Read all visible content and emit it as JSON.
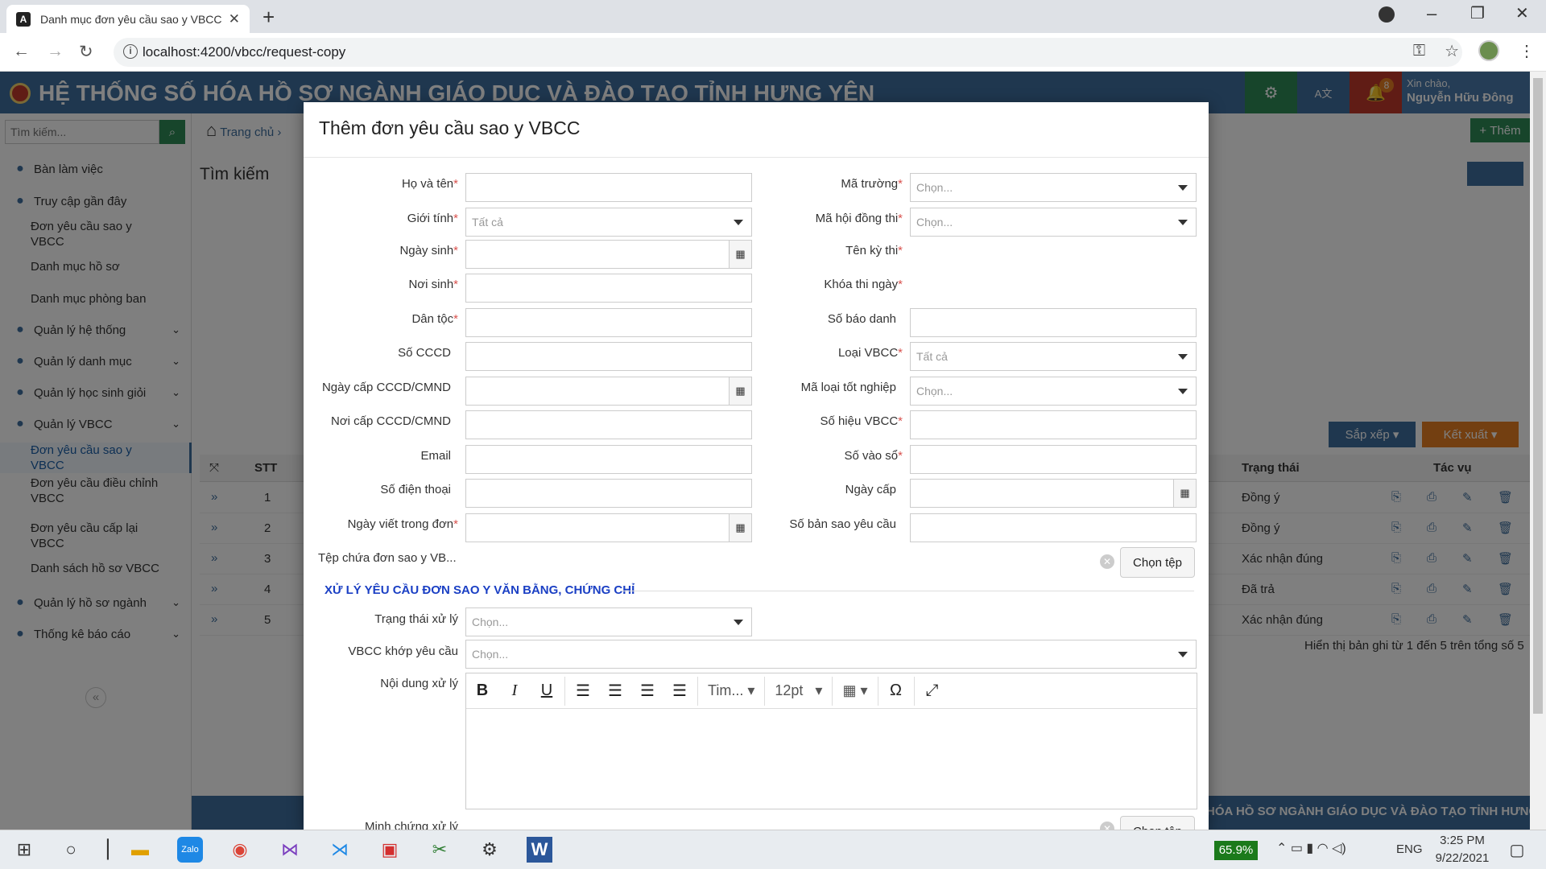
{
  "browser": {
    "tab_title": "Danh mục đơn yêu cầu sao y VBCC",
    "url": "localhost:4200/vbcc/request-copy",
    "tab_close": "✕",
    "new_tab": "+"
  },
  "app": {
    "title": "HỆ THỐNG SỐ HÓA HỒ SƠ NGÀNH GIÁO DỤC VÀ ĐÀO TẠO TỈNH HƯNG YÊN",
    "notify_count": "8",
    "greeting": "Xin chào,",
    "user": "Nguyễn Hữu Đông",
    "breadcrumb": "Trang chủ",
    "add_button": "Thêm",
    "search_placeholder": "Tìm kiếm...",
    "page_heading": "Tìm kiếm",
    "sort": "Sắp xếp",
    "export": "Kết xuất",
    "footer_text": "HÓA HỒ SƠ NGÀNH GIÁO DỤC VÀ ĐÀO TẠO TỈNH HƯNG YÊ",
    "pagination": "Hiển thị bản ghi từ 1 đến 5 trên tổng số 5"
  },
  "sidebar": {
    "items": [
      {
        "label": "Bàn làm việc",
        "icon": "dashboard-icon",
        "sub": false
      },
      {
        "label": "Truy cập gần đây",
        "icon": "users-icon",
        "sub": false
      },
      {
        "label": "Đơn yêu cầu sao y VBCC",
        "sub": true
      },
      {
        "label": "Danh mục hồ sơ",
        "sub": true
      },
      {
        "label": "Danh mục phòng ban",
        "sub": true
      },
      {
        "label": "Quản lý hệ thống",
        "icon": "users-cog-icon",
        "sub": false,
        "chev": true
      },
      {
        "label": "Quản lý danh mục",
        "icon": "list-icon",
        "sub": false,
        "chev": true
      },
      {
        "label": "Quản lý học sinh giỏi",
        "icon": "medal-icon",
        "sub": false,
        "chev": true
      },
      {
        "label": "Quản lý VBCC",
        "icon": "graduation-icon",
        "sub": false,
        "chev": true
      },
      {
        "label": "Đơn yêu cầu sao y VBCC",
        "sub": true,
        "active": true
      },
      {
        "label": "Đơn yêu cầu điều chỉnh VBCC",
        "sub": true
      },
      {
        "label": "Đơn yêu cầu cấp lại VBCC",
        "sub": true
      },
      {
        "label": "Danh sách hồ sơ VBCC",
        "sub": true
      },
      {
        "label": "Quản lý hồ sơ ngành",
        "icon": "folder-icon",
        "sub": false,
        "chev": true
      },
      {
        "label": "Thống kê báo cáo",
        "icon": "chart-icon",
        "sub": false,
        "chev": true
      }
    ]
  },
  "table": {
    "headers": {
      "stt": "STT",
      "status": "Trạng thái",
      "actions": "Tác vụ"
    },
    "rows": [
      {
        "stt": "1",
        "status": "Đồng ý"
      },
      {
        "stt": "2",
        "status": "Đồng ý"
      },
      {
        "stt": "3",
        "status": "Xác nhận đúng"
      },
      {
        "stt": "4",
        "status": "Đã trả"
      },
      {
        "stt": "5",
        "status": "Xác nhận đúng"
      }
    ]
  },
  "modal": {
    "title": "Thêm đơn yêu cầu sao y VBCC",
    "left": {
      "ho_ten": "Họ và tên",
      "gioi_tinh": "Giới tính",
      "ngay_sinh": "Ngày sinh",
      "noi_sinh": "Nơi sinh",
      "dan_toc": "Dân tộc",
      "so_cccd": "Số CCCD",
      "ngay_cap_cccd": "Ngày cấp CCCD/CMND",
      "noi_cap_cccd": "Nơi cấp CCCD/CMND",
      "email": "Email",
      "so_dien_thoai": "Số điện thoại",
      "ngay_viet": "Ngày viết trong đơn"
    },
    "right": {
      "ma_truong": "Mã trường",
      "ma_hoi_dong": "Mã hội đồng thi",
      "ten_ky_thi": "Tên kỳ thi",
      "khoa_thi": "Khóa thi ngày",
      "so_bao_danh": "Số báo danh",
      "loai_vbcc": "Loại VBCC",
      "ma_loai_tot_nghiep": "Mã loại tốt nghiệp",
      "so_hieu": "Số hiệu VBCC",
      "so_vao_so": "Số vào sổ",
      "ngay_cap": "Ngày cấp",
      "so_ban_sao": "Số bản sao yêu cầu"
    },
    "placeholders": {
      "tat_ca": "Tất cả",
      "chon": "Chọn..."
    },
    "file_label": "Tệp chứa đơn sao y VB...",
    "choose_file": "Chọn tệp",
    "section_title": "XỬ LÝ YÊU CẦU ĐƠN SAO Y VĂN BẰNG, CHỨNG CHỈ",
    "trang_thai": "Trạng thái xử lý",
    "vbcc_khop": "VBCC khớp yêu cầu",
    "noi_dung": "Nội dung xử lý",
    "minh_chung": "Minh chứng xử lý",
    "editor": {
      "font": "Tim...",
      "size": "12pt"
    }
  },
  "taskbar": {
    "battery": "65.9%",
    "lang": "ENG",
    "time": "3:25 PM",
    "date": "9/22/2021"
  }
}
